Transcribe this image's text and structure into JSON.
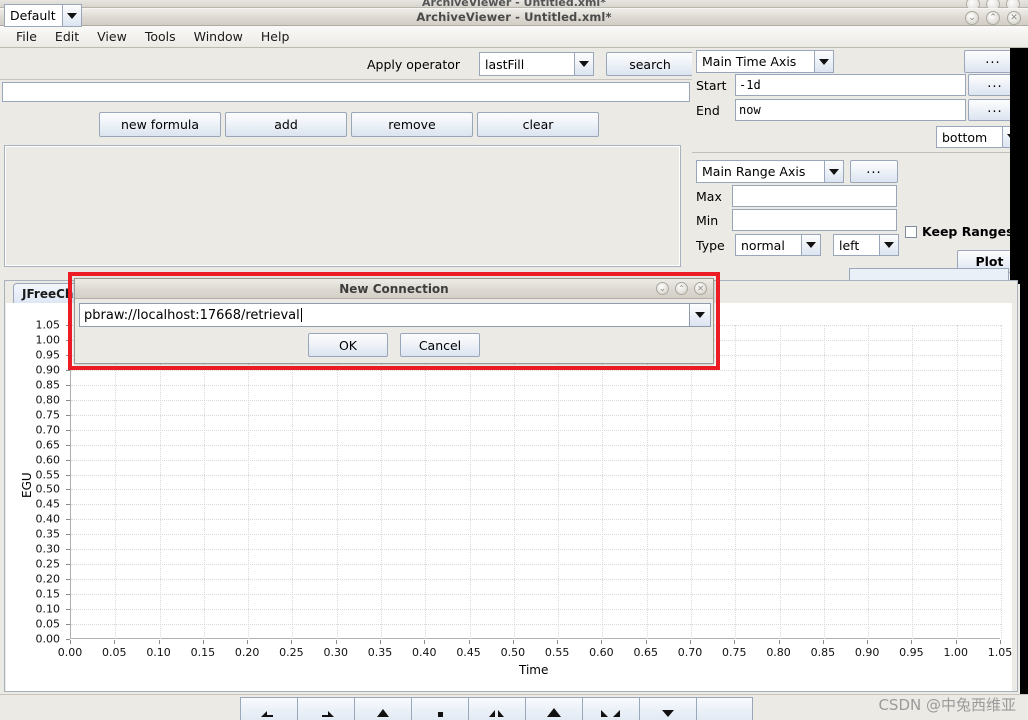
{
  "background_window": {
    "title": "ArchiveViewer - Untitled.xml*"
  },
  "window": {
    "title": "ArchiveViewer - Untitled.xml*",
    "controls": [
      {
        "name": "minimize",
        "glyph": "⌄"
      },
      {
        "name": "maximize",
        "glyph": "⌃"
      },
      {
        "name": "close",
        "glyph": "✕"
      }
    ]
  },
  "menubar": {
    "items": [
      {
        "label": "File"
      },
      {
        "label": "Edit"
      },
      {
        "label": "View"
      },
      {
        "label": "Tools"
      },
      {
        "label": "Window"
      },
      {
        "label": "Help"
      }
    ]
  },
  "toolbar": {
    "config_combo": {
      "value": "Default"
    },
    "apply_operator_label": "Apply operator",
    "operator_combo": {
      "value": "lastFill"
    },
    "search_button": "search",
    "pv_field": {
      "value": "",
      "placeholder": ""
    }
  },
  "formula_buttons": [
    {
      "label": "new formula"
    },
    {
      "label": "add"
    },
    {
      "label": "remove"
    },
    {
      "label": "clear"
    }
  ],
  "time_axis": {
    "axis_combo": {
      "value": "Main Time Axis"
    },
    "config_button": "...",
    "start_label": "Start",
    "start_value": "-1d",
    "start_button": "...",
    "end_label": "End",
    "end_value": "now",
    "end_button": "...",
    "position_combo": {
      "value": "bottom"
    }
  },
  "range_axis": {
    "axis_combo": {
      "value": "Main Range Axis"
    },
    "config_button": "...",
    "max_label": "Max",
    "max_value": "",
    "min_label": "Min",
    "min_value": "",
    "type_label": "Type",
    "type_combo": {
      "value": "normal"
    },
    "side_combo": {
      "value": "left"
    },
    "keep_ranges_label": "Keep Ranges",
    "keep_ranges_checked": false,
    "plot_button": "Plot"
  },
  "chart_panel": {
    "tab_label": "JFreeCha",
    "restore_icon": "restore-window-icon"
  },
  "dialog": {
    "title": "New Connection",
    "url_value": "pbraw://localhost:17668/retrieval",
    "ok_button": "OK",
    "cancel_button": "Cancel",
    "controls": [
      {
        "name": "minimize",
        "glyph": "⌄"
      },
      {
        "name": "maximize",
        "glyph": "⌃"
      },
      {
        "name": "close",
        "glyph": "✕"
      }
    ]
  },
  "bottom_toolbar": {
    "buttons": [
      {
        "name": "nav-back-icon"
      },
      {
        "name": "nav-forward-icon"
      },
      {
        "name": "zoom-up-icon"
      },
      {
        "name": "stop-icon"
      },
      {
        "name": "zoom-in-horizontal-icon"
      },
      {
        "name": "zoom-in-icon"
      },
      {
        "name": "zoom-out-horizontal-icon"
      },
      {
        "name": "scroll-down-icon"
      },
      {
        "name": "blank-icon"
      }
    ]
  },
  "watermark": {
    "text": "CSDN @中兔西维亚"
  },
  "colors": {
    "highlight_box": "#ec1c24",
    "panel_bg": "#eceae5",
    "chart_bg": "#ffffff",
    "gridline": "#d9d9d9"
  },
  "chart_data": {
    "type": "line",
    "title": "",
    "xlabel": "Time",
    "ylabel": "EGU",
    "xlim": [
      0.0,
      1.05
    ],
    "ylim": [
      0.0,
      1.05
    ],
    "xticks": [
      0.0,
      0.05,
      0.1,
      0.15,
      0.2,
      0.25,
      0.3,
      0.35,
      0.4,
      0.45,
      0.5,
      0.55,
      0.6,
      0.65,
      0.7,
      0.75,
      0.8,
      0.85,
      0.9,
      0.95,
      1.0,
      1.05
    ],
    "xtick_labels": [
      "0.00",
      "0.05",
      "0.10",
      "0.15",
      "0.20",
      "0.25",
      "0.30",
      "0.35",
      "0.40",
      "0.45",
      "0.50",
      "0.55",
      "0.60",
      "0.65",
      "0.70",
      "0.75",
      "0.80",
      "0.85",
      "0.90",
      "0.95",
      "1.00",
      "1.05"
    ],
    "yticks": [
      0.0,
      0.05,
      0.1,
      0.15,
      0.2,
      0.25,
      0.3,
      0.35,
      0.4,
      0.45,
      0.5,
      0.55,
      0.6,
      0.65,
      0.7,
      0.75,
      0.8,
      0.85,
      0.9,
      0.95,
      1.0,
      1.05
    ],
    "ytick_labels": [
      "0.00",
      "0.05",
      "0.10",
      "0.15",
      "0.20",
      "0.25",
      "0.30",
      "0.35",
      "0.40",
      "0.45",
      "0.50",
      "0.55",
      "0.60",
      "0.65",
      "0.70",
      "0.75",
      "0.80",
      "0.85",
      "0.90",
      "0.95",
      "1.00",
      "1.05"
    ],
    "grid": true,
    "legend": false,
    "series": []
  }
}
